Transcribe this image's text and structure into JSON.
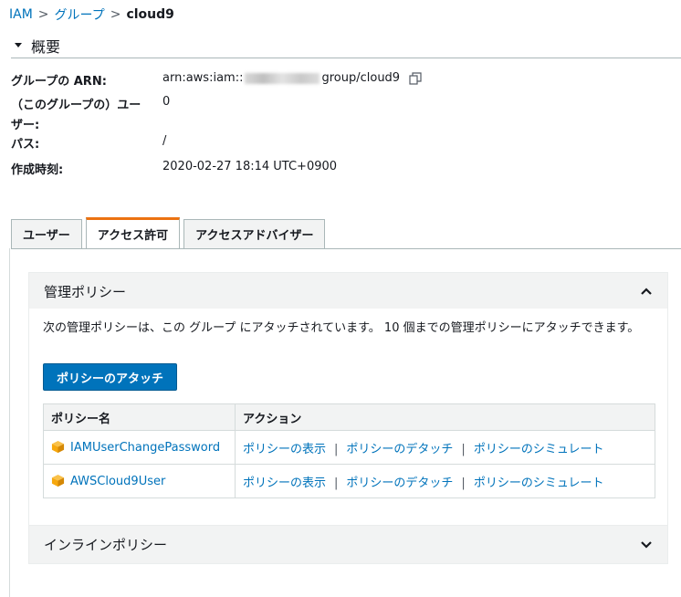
{
  "breadcrumb": {
    "root": "IAM",
    "sep": ">",
    "groups": "グループ",
    "current": "cloud9"
  },
  "summary": {
    "title": "概要",
    "rows": [
      {
        "key": "グループの ARN:",
        "value_prefix": "arn:aws:iam::",
        "value_suffix": "group/cloud9"
      },
      {
        "key_line1": "（このグループの）ユー",
        "key_line2": "ザー:",
        "value": "0"
      },
      {
        "key": "パス:",
        "value": "/"
      },
      {
        "key": "作成時刻:",
        "value": "2020-02-27 18:14 UTC+0900"
      }
    ]
  },
  "tabs": [
    {
      "label": "ユーザー"
    },
    {
      "label": "アクセス許可"
    },
    {
      "label": "アクセスアドバイザー"
    }
  ],
  "managed": {
    "title": "管理ポリシー",
    "description": "次の管理ポリシーは、この グループ にアタッチされています。 10 個までの管理ポリシーにアタッチできます。",
    "attach_button": "ポリシーのアタッチ",
    "columns": [
      "ポリシー名",
      "アクション"
    ],
    "rows": [
      {
        "name": "IAMUserChangePassword",
        "show": "ポリシーの表示",
        "detach": "ポリシーのデタッチ",
        "simulate": "ポリシーのシミュレート"
      },
      {
        "name": "AWSCloud9User",
        "show": "ポリシーの表示",
        "detach": "ポリシーのデタッチ",
        "simulate": "ポリシーのシミュレート"
      }
    ],
    "separator": "|"
  },
  "inline": {
    "title": "インラインポリシー"
  },
  "colors": {
    "link": "#0073bb",
    "primary_button": "#0073bb",
    "active_tab": "#ec7211",
    "policy_icon": "#f7a80d"
  }
}
